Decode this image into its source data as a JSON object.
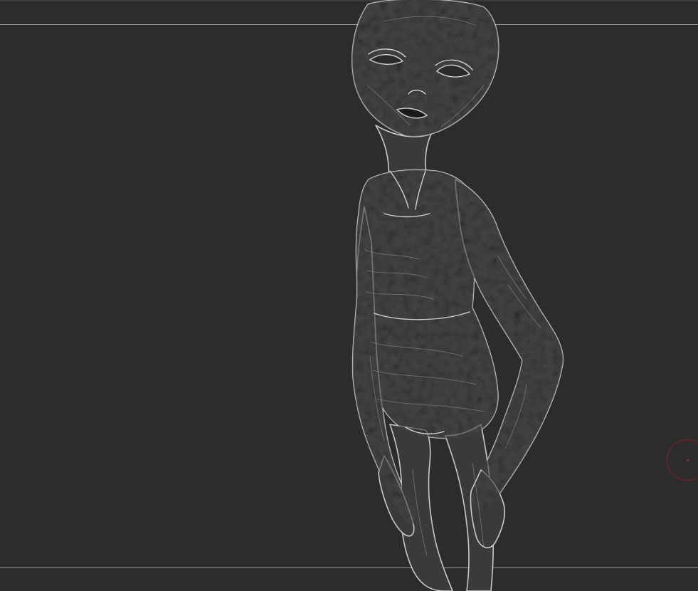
{
  "viewport": {
    "background_color": "#2c2c2c",
    "guide_color": "#9a9a9a",
    "model_fill": "#3a3a3a",
    "model_highlight": "#bdbdbd",
    "model_shadow": "#111111"
  },
  "subject": {
    "name": "alien-figure-sculpt"
  },
  "brush_cursor": {
    "color": "#8a1e24"
  }
}
